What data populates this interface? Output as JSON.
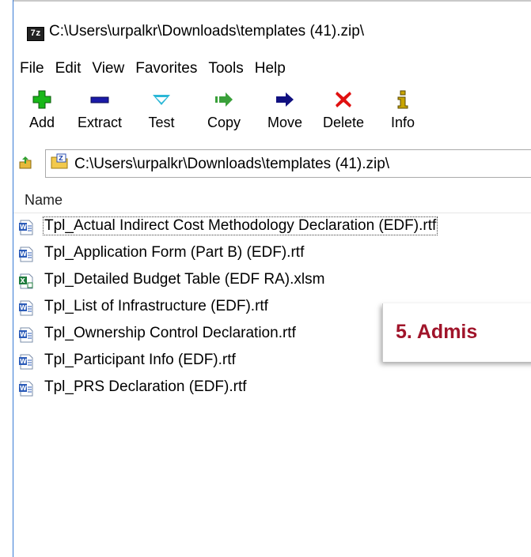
{
  "window": {
    "app_icon_text": "7z",
    "title": "C:\\Users\\urpalkr\\Downloads\\templates (41).zip\\"
  },
  "menu": [
    "File",
    "Edit",
    "View",
    "Favorites",
    "Tools",
    "Help"
  ],
  "toolbar": {
    "add": "Add",
    "extract": "Extract",
    "test": "Test",
    "copy": "Copy",
    "move": "Move",
    "delete": "Delete",
    "info": "Info"
  },
  "address": {
    "path": "C:\\Users\\urpalkr\\Downloads\\templates (41).zip\\"
  },
  "list": {
    "column_name": "Name",
    "files": [
      {
        "name": "Tpl_Actual Indirect Cost Methodology Declaration (EDF).rtf",
        "icon": "word-doc-icon"
      },
      {
        "name": "Tpl_Application Form (Part B) (EDF).rtf",
        "icon": "word-doc-icon"
      },
      {
        "name": "Tpl_Detailed Budget Table (EDF RA).xlsm",
        "icon": "excel-doc-icon"
      },
      {
        "name": "Tpl_List of Infrastructure (EDF).rtf",
        "icon": "word-doc-icon"
      },
      {
        "name": "Tpl_Ownership Control Declaration.rtf",
        "icon": "word-doc-icon"
      },
      {
        "name": "Tpl_Participant Info (EDF).rtf",
        "icon": "word-doc-icon"
      },
      {
        "name": "Tpl_PRS Declaration (EDF).rtf",
        "icon": "word-doc-icon"
      }
    ]
  },
  "overlay": {
    "text": "5. Admis"
  },
  "colors": {
    "add_green": "#19b719",
    "extract_blue": "#1a1aa8",
    "test_cyan": "#2bb7d6",
    "arrow_green": "#3aa03a",
    "move_navy": "#101080",
    "delete_red": "#e01010",
    "info_yellow": "#c8a400",
    "overlay_red": "#a0142a"
  }
}
